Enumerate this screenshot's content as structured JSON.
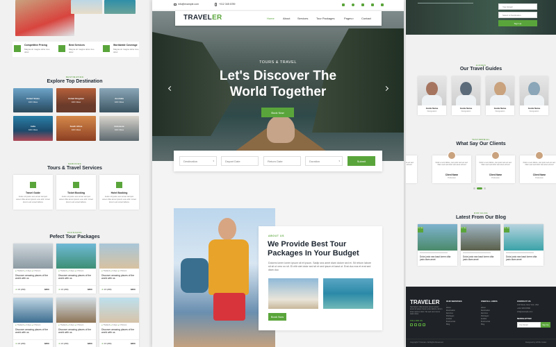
{
  "colors": {
    "accent": "#5aa53b",
    "dark": "#1f2328",
    "light_bg": "#ececec"
  },
  "topbar": {
    "email": "info@example.com",
    "phone": "+012 345 6789"
  },
  "header": {
    "logo_main": "TRAVEL",
    "logo_accent": "ER",
    "nav": [
      "Home",
      "About",
      "Services",
      "Tour Packages",
      "Pages",
      "Contact"
    ]
  },
  "hero": {
    "kicker": "TOURS & TRAVEL",
    "title_line1": "Let's Discover The",
    "title_line2": "World Together",
    "button": "Book Now"
  },
  "search": {
    "destination": "Destination",
    "depart": "Depart Date",
    "return": "Return Date",
    "duration": "Duration",
    "submit": "Submit"
  },
  "about": {
    "kicker": "ABOUT US",
    "title_line1": "We Provide Best Tour",
    "title_line2": "Packages In Your Budget",
    "text": "Dolores lorem lorem ipsum sit et ipsum. Sadip sea amet diam dolore sed et. Sit rebum labore sit sit ut vero no sit. Et elitr stet dolor sed sit et sed ipsum et kasd ut. Erat duo eos et erat sed diam duo",
    "button": "Book Now"
  },
  "left_features": [
    {
      "title": "Competitive Pricing",
      "text": "Magna sit magna dolor duo dolor"
    },
    {
      "title": "Best Services",
      "text": "Magna sit magna dolor duo dolor"
    },
    {
      "title": "Worldwide Coverage",
      "text": "Magna sit magna dolor duo dolor"
    }
  ],
  "destinations": {
    "kicker": "DESTINATION",
    "title": "Explore Top Destination",
    "items": [
      {
        "name": "United States",
        "count": "100 Cities"
      },
      {
        "name": "United Kingdom",
        "count": "100 Cities"
      },
      {
        "name": "Australia",
        "count": "100 Cities"
      },
      {
        "name": "India",
        "count": "100 Cities"
      },
      {
        "name": "South Africa",
        "count": "100 Cities"
      },
      {
        "name": "Indonesia",
        "count": "100 Cities"
      }
    ]
  },
  "services": {
    "kicker": "SERVICES",
    "title": "Tours & Travel Services",
    "items": [
      {
        "name": "Travel Guide",
        "text": "Justo sit justo eos amet tempor amet clita amet ipsum eos elitr. Amet lorem est amet labore"
      },
      {
        "name": "Ticket Booking",
        "text": "Justo sit justo eos amet tempor amet clita amet ipsum eos elitr. Amet lorem est amet labore"
      },
      {
        "name": "Hotel Booking",
        "text": "Justo sit justo eos amet tempor amet clita amet ipsum eos elitr. Amet lorem est amet labore"
      }
    ]
  },
  "packages": {
    "kicker": "PACKAGES",
    "title": "Pefect Tour Packages",
    "items": [
      {
        "place": "Thailand",
        "days": "3 days",
        "people": "2 Person",
        "title": "Discover amazing places of the world with us",
        "rating": "4.5 (250)",
        "price": "$350"
      },
      {
        "place": "Thailand",
        "days": "3 days",
        "people": "2 Person",
        "title": "Discover amazing places of the world with us",
        "rating": "4.5 (250)",
        "price": "$350"
      },
      {
        "place": "Thailand",
        "days": "3 days",
        "people": "2 Person",
        "title": "Discover amazing places of the world with us",
        "rating": "4.5 (250)",
        "price": "$350"
      },
      {
        "place": "Thailand",
        "days": "3 days",
        "people": "2 Person",
        "title": "Discover amazing places of the world with us",
        "rating": "4.5 (250)",
        "price": "$350"
      },
      {
        "place": "Thailand",
        "days": "3 days",
        "people": "2 Person",
        "title": "Discover amazing places of the world with us",
        "rating": "4.5 (250)",
        "price": "$350"
      },
      {
        "place": "Thailand",
        "days": "3 days",
        "people": "2 Person",
        "title": "Discover amazing places of the world with us",
        "rating": "4.5 (250)",
        "price": "$350"
      }
    ]
  },
  "guides": {
    "kicker": "GUIDES",
    "title": "Our Travel Guides",
    "items": [
      {
        "name": "Guide Name",
        "role": "Designation"
      },
      {
        "name": "Guide Name",
        "role": "Designation"
      },
      {
        "name": "Guide Name",
        "role": "Designation"
      },
      {
        "name": "Guide Name",
        "role": "Designation"
      }
    ]
  },
  "testimonial": {
    "kicker": "TESTIMONIAL",
    "title": "What Say Our Clients",
    "items": [
      {
        "name": "Client Name",
        "role": "Profession",
        "text": "Dolor et eos labore, stet justo sed est sed. Diam sed sed dolor stet amet eirmod"
      },
      {
        "name": "Client Name",
        "role": "Profession",
        "text": "Dolor et eos labore, stet justo sed est sed. Diam sed sed dolor stet amet eirmod"
      },
      {
        "name": "Client Name",
        "role": "Profession",
        "text": "Dolor et eos labore, stet justo sed est sed. Diam sed sed dolor stet amet eirmod"
      },
      {
        "name": "Client Name",
        "role": "Profession",
        "text": "Dolor et eos labore, stet justo sed est sed. Diam sed sed dolor stet amet eirmod"
      }
    ]
  },
  "blog": {
    "kicker": "OUR BLOG",
    "title": "Latest From Our Blog",
    "items": [
      {
        "date": "01 Jan",
        "text": "Dolor justo sea kasd lorem clita justo diam amet"
      },
      {
        "date": "01 Jan",
        "text": "Dolor justo sea kasd lorem clita justo diam amet"
      },
      {
        "date": "01 Jan",
        "text": "Dolor justo sea kasd lorem clita justo diam amet"
      }
    ]
  },
  "footer": {
    "logo": "TRAVELER",
    "about": "Sed ipsum clita tempor ipsum ipsum amet sit ipsum lorem amet labore rebum lorem ipsum dolor. No sed vero lorem dolor dolor",
    "follow": "FOLLOW US",
    "services_title": "OUR SERVICES",
    "services": [
      "About",
      "Destination",
      "Services",
      "Packages",
      "Guides",
      "Testimonial",
      "Blog"
    ],
    "links_title": "USEFULL LINKS",
    "links": [
      "About",
      "Destination",
      "Services",
      "Packages",
      "Guides",
      "Testimonial",
      "Blog"
    ],
    "contact_title": "CONTACT US",
    "contact": [
      "123 Street, New York, USA",
      "+012 345 67890",
      "info@example.com"
    ],
    "newsletter": "NEWSLETTER",
    "email_placeholder": "Your Email",
    "signup": "Sign Up",
    "copyright": "Copyright © Domain. All Rights Reserved.",
    "designed": "Designed by HTML Codex"
  },
  "booking_widget": {
    "email": "Your Email",
    "select": "Select A Destination",
    "button": "Sign Up"
  }
}
